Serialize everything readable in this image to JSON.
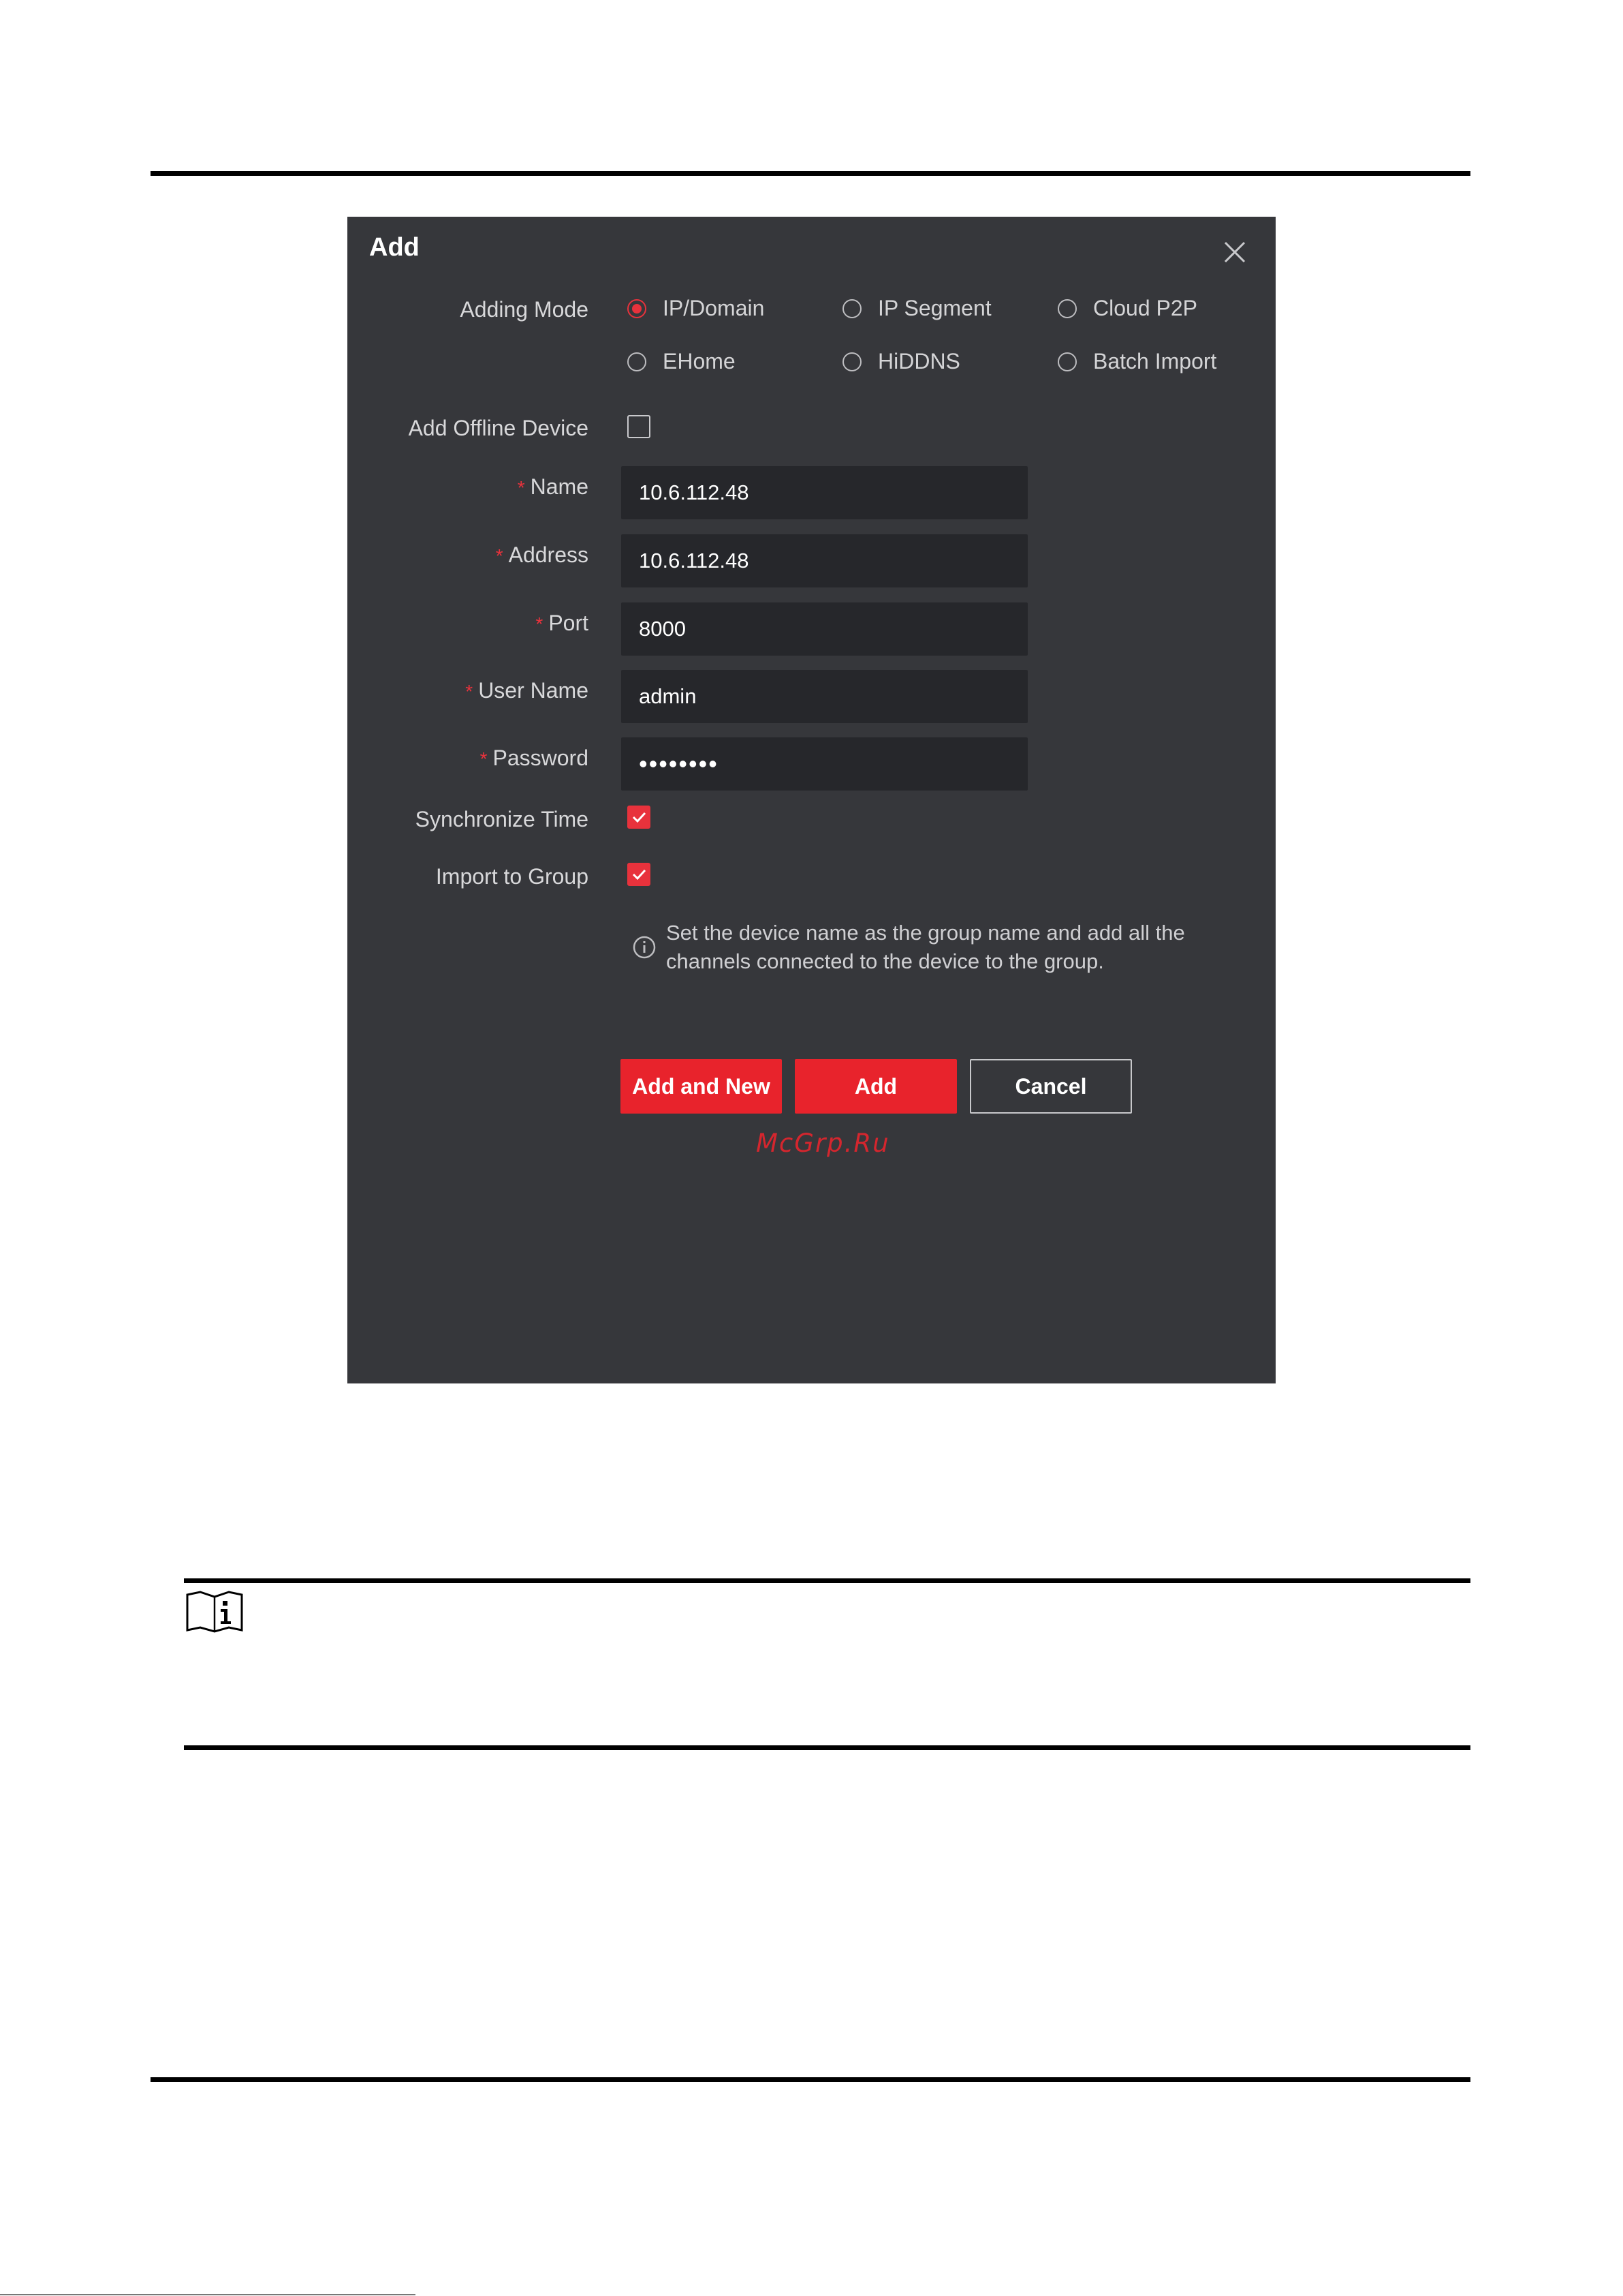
{
  "dialog": {
    "title": "Add",
    "close_icon": "close-icon",
    "adding_mode": {
      "label": "Adding Mode",
      "options": [
        {
          "label": "IP/Domain",
          "selected": true
        },
        {
          "label": "IP Segment",
          "selected": false
        },
        {
          "label": "Cloud P2P",
          "selected": false
        },
        {
          "label": "EHome",
          "selected": false
        },
        {
          "label": "HiDDNS",
          "selected": false
        },
        {
          "label": "Batch Import",
          "selected": false
        }
      ]
    },
    "add_offline_device": {
      "label": "Add Offline Device",
      "checked": false
    },
    "fields": {
      "name": {
        "label": "Name",
        "required_mark": "*",
        "value": "10.6.112.48"
      },
      "address": {
        "label": "Address",
        "required_mark": "*",
        "value": "10.6.112.48"
      },
      "port": {
        "label": "Port",
        "required_mark": "*",
        "value": "8000"
      },
      "user_name": {
        "label": "User Name",
        "required_mark": "*",
        "value": "admin"
      },
      "password": {
        "label": "Password",
        "required_mark": "*",
        "value": "••••••••"
      }
    },
    "synchronize_time": {
      "label": "Synchronize Time",
      "checked": true
    },
    "import_to_group": {
      "label": "Import to Group",
      "checked": true
    },
    "info": {
      "icon": "info-icon",
      "line1": "Set the device name as the group name and add all the",
      "line2": "channels connected to the device to the group."
    },
    "buttons": {
      "add_and_new": "Add and New",
      "add": "Add",
      "cancel": "Cancel"
    },
    "watermark": "McGrp.Ru"
  },
  "note": {
    "icon": "note-book-icon"
  },
  "colors": {
    "accent": "#e8232c",
    "dialog_bg": "#36373b",
    "field_bg": "#26272b"
  }
}
